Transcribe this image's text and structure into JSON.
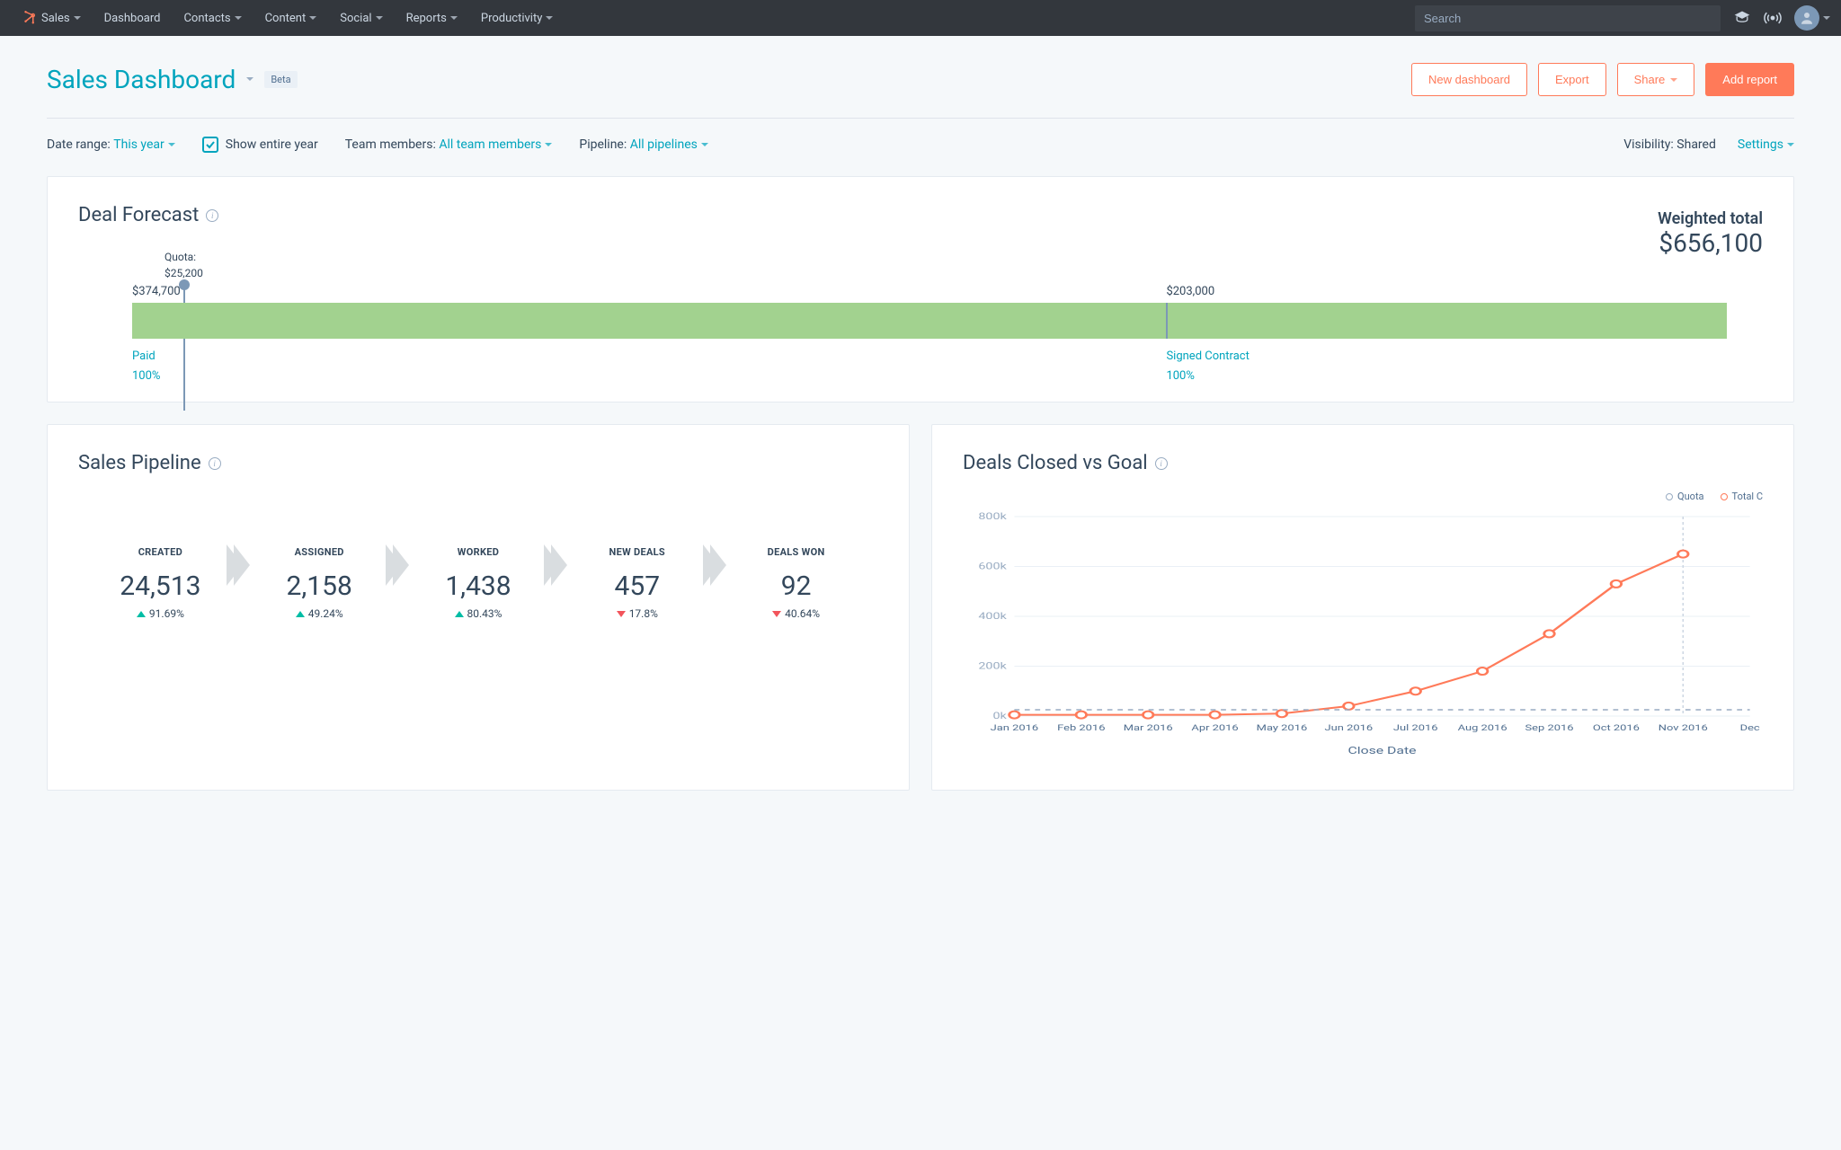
{
  "nav": {
    "brand": "Sales",
    "items": [
      "Dashboard",
      "Contacts",
      "Content",
      "Social",
      "Reports",
      "Productivity"
    ],
    "search_placeholder": "Search"
  },
  "header": {
    "title": "Sales Dashboard",
    "beta": "Beta",
    "actions": {
      "new_dashboard": "New dashboard",
      "export": "Export",
      "share": "Share",
      "add_report": "Add report"
    }
  },
  "filters": {
    "date_range_label": "Date range:",
    "date_range_value": "This year",
    "show_entire_year": "Show entire year",
    "team_label": "Team members:",
    "team_value": "All team members",
    "pipeline_label": "Pipeline:",
    "pipeline_value": "All pipelines",
    "visibility_label": "Visibility:",
    "visibility_value": "Shared",
    "settings": "Settings"
  },
  "forecast": {
    "title": "Deal Forecast",
    "weighted_total_label": "Weighted total",
    "weighted_total_value": "$656,100",
    "quota_label": "Quota:",
    "quota_value": "$25,200",
    "segments": [
      {
        "value": "$374,700",
        "name": "Paid",
        "pct": "100%"
      },
      {
        "value": "$203,000",
        "name": "Signed Contract",
        "pct": "100%"
      }
    ]
  },
  "pipeline": {
    "title": "Sales Pipeline",
    "stages": [
      {
        "label": "CREATED",
        "value": "24,513",
        "pct": "91.69%",
        "direction": "up"
      },
      {
        "label": "ASSIGNED",
        "value": "2,158",
        "pct": "49.24%",
        "direction": "up"
      },
      {
        "label": "WORKED",
        "value": "1,438",
        "pct": "80.43%",
        "direction": "up"
      },
      {
        "label": "NEW DEALS",
        "value": "457",
        "pct": "17.8%",
        "direction": "down"
      },
      {
        "label": "DEALS WON",
        "value": "92",
        "pct": "40.64%",
        "direction": "down"
      }
    ]
  },
  "deals_chart": {
    "title": "Deals Closed vs Goal",
    "legend": {
      "quota": "Quota",
      "total": "Total C"
    },
    "xlabel": "Close Date"
  },
  "chart_data": {
    "type": "line",
    "title": "Deals Closed vs Goal",
    "xlabel": "Close Date",
    "ylabel": "",
    "ylim": [
      0,
      800000
    ],
    "y_ticks": [
      "0k",
      "200k",
      "400k",
      "600k",
      "800k"
    ],
    "categories": [
      "Jan 2016",
      "Feb 2016",
      "Mar 2016",
      "Apr 2016",
      "May 2016",
      "Jun 2016",
      "Jul 2016",
      "Aug 2016",
      "Sep 2016",
      "Oct 2016",
      "Nov 2016",
      "Dec"
    ],
    "series": [
      {
        "name": "Total C",
        "color": "#ff7a59",
        "values": [
          5000,
          5000,
          5000,
          5000,
          10000,
          40000,
          100000,
          180000,
          330000,
          530000,
          650000,
          null
        ]
      },
      {
        "name": "Quota",
        "color": "#99acc2",
        "dashed": true,
        "values": [
          25200,
          25200,
          25200,
          25200,
          25200,
          25200,
          25200,
          25200,
          25200,
          25200,
          25200,
          25200
        ]
      }
    ]
  }
}
